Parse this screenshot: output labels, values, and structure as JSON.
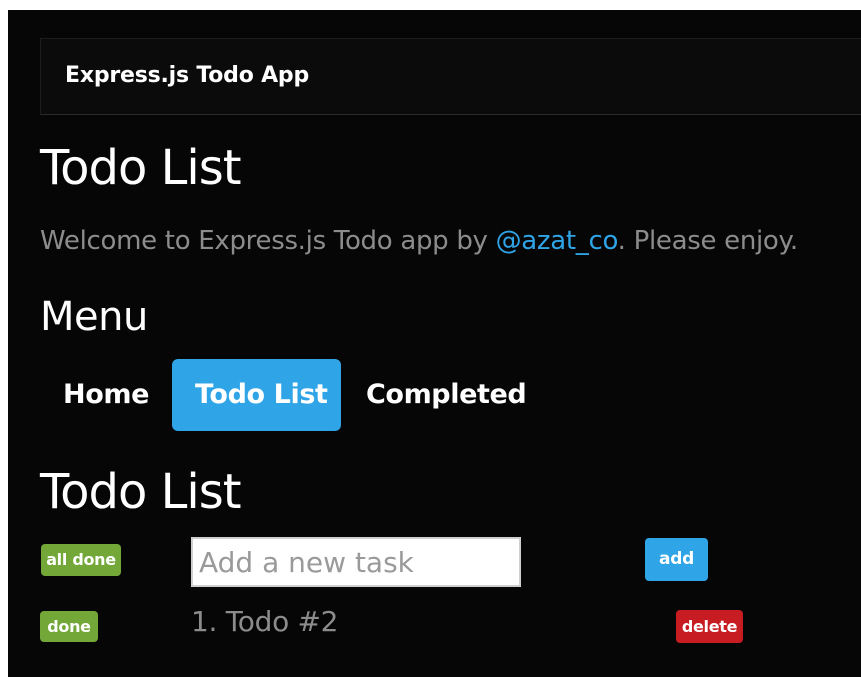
{
  "navbar": {
    "brand": "Express.js Todo App"
  },
  "page": {
    "title": "Todo List",
    "lead_prefix": "Welcome to Express.js Todo app by ",
    "lead_link": "@azat_co",
    "lead_suffix": ". Please enjoy."
  },
  "menu": {
    "title": "Menu",
    "items": [
      {
        "label": "Home",
        "active": false
      },
      {
        "label": "Todo List",
        "active": true
      },
      {
        "label": "Completed",
        "active": false
      }
    ]
  },
  "todo": {
    "title": "Todo List",
    "all_done_label": "all done",
    "input_placeholder": "Add a new task",
    "input_value": "",
    "add_label": "add",
    "items": [
      {
        "text": "1. Todo #2",
        "done_label": "done",
        "delete_label": "delete"
      }
    ]
  },
  "colors": {
    "primary": "#2fa4e7",
    "success": "#73a839",
    "danger": "#c71c22",
    "background": "#060606",
    "muted_text": "#8c8c8c"
  }
}
